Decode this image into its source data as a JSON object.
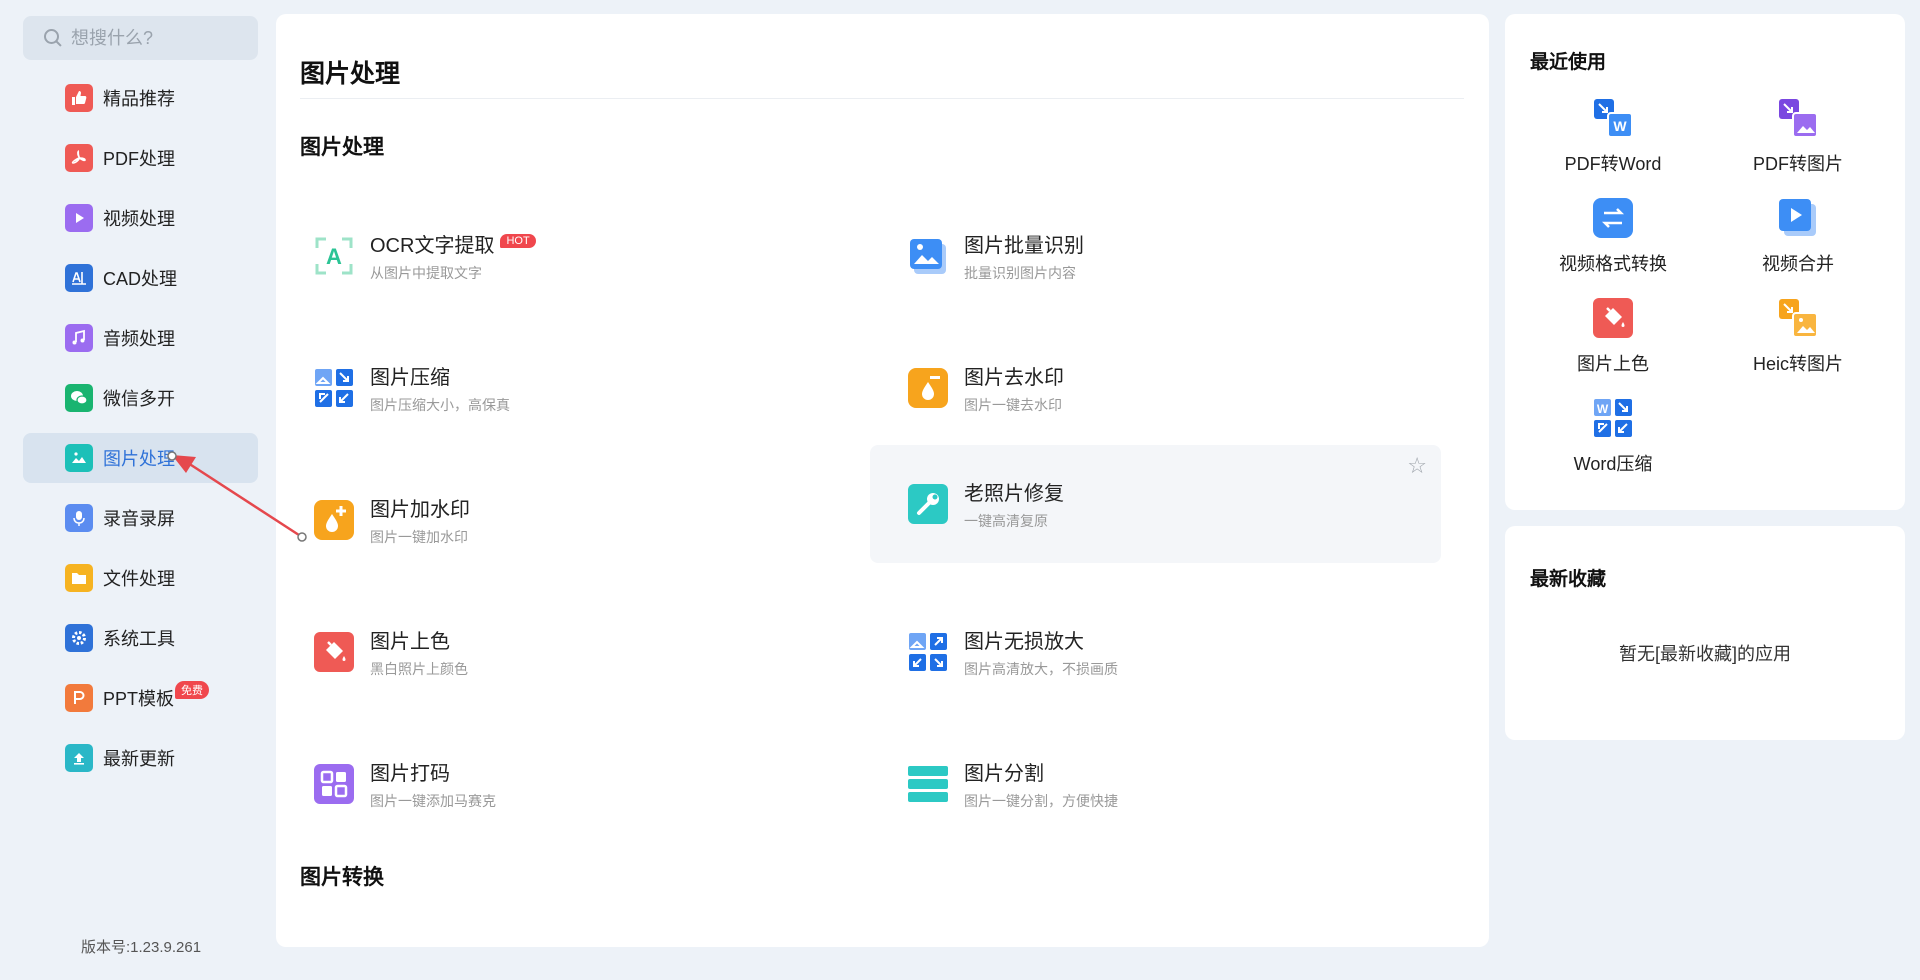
{
  "search": {
    "placeholder": "想搜什么?"
  },
  "sidebar": {
    "items": [
      {
        "label": "精品推荐",
        "icon": "thumbs-up-icon",
        "color": "#ef5a55"
      },
      {
        "label": "PDF处理",
        "icon": "pdf-icon",
        "color": "#ef5a55"
      },
      {
        "label": "视频处理",
        "icon": "video-play-icon",
        "color": "#9b6cf0"
      },
      {
        "label": "CAD处理",
        "icon": "cad-icon",
        "color": "#2f72d8"
      },
      {
        "label": "音频处理",
        "icon": "music-note-icon",
        "color": "#9b6cf0"
      },
      {
        "label": "微信多开",
        "icon": "wechat-icon",
        "color": "#19b470"
      },
      {
        "label": "图片处理",
        "icon": "image-icon",
        "color": "#1cc0b8"
      },
      {
        "label": "录音录屏",
        "icon": "microphone-icon",
        "color": "#5b8cf0"
      },
      {
        "label": "文件处理",
        "icon": "folder-icon",
        "color": "#f6b321"
      },
      {
        "label": "系统工具",
        "icon": "gear-icon",
        "color": "#2f72d8"
      },
      {
        "label": "PPT模板",
        "icon": "ppt-icon",
        "color": "#f27a3c",
        "badge": "免费"
      },
      {
        "label": "最新更新",
        "icon": "upload-icon",
        "color": "#2ab7c7"
      }
    ]
  },
  "version": "版本号:1.23.9.261",
  "main": {
    "title": "图片处理",
    "section1": "图片处理",
    "section2": "图片转换",
    "tools": [
      {
        "name": "OCR文字提取",
        "desc": "从图片中提取文字",
        "badge": "HOT",
        "icon": "ocr-text-icon",
        "color": "#2cc495"
      },
      {
        "name": "图片批量识别",
        "desc": "批量识别图片内容",
        "icon": "image-batch-icon",
        "color": "#3d8ef5"
      },
      {
        "name": "图片压缩",
        "desc": "图片压缩大小，高保真",
        "icon": "image-compress-icon",
        "color": "#3d8ef5"
      },
      {
        "name": "图片去水印",
        "desc": "图片一键去水印",
        "icon": "remove-watermark-icon",
        "color": "#f7a41d"
      },
      {
        "name": "图片加水印",
        "desc": "图片一键加水印",
        "icon": "add-watermark-icon",
        "color": "#f7a41d"
      },
      {
        "name": "老照片修复",
        "desc": "一键高清复原",
        "icon": "photo-repair-icon",
        "color": "#2cc9c4"
      },
      {
        "name": "图片上色",
        "desc": "黑白照片上颜色",
        "icon": "paint-bucket-icon",
        "color": "#ef5a55"
      },
      {
        "name": "图片无损放大",
        "desc": "图片高清放大，不损画质",
        "icon": "image-enlarge-icon",
        "color": "#3d8ef5"
      },
      {
        "name": "图片打码",
        "desc": "图片一键添加马赛克",
        "icon": "mosaic-icon",
        "color": "#9b6cf0"
      },
      {
        "name": "图片分割",
        "desc": "图片一键分割，方便快捷",
        "icon": "image-split-icon",
        "color": "#2cc9c4"
      }
    ]
  },
  "recent": {
    "title": "最近使用",
    "items": [
      {
        "label": "PDF转Word",
        "icon": "pdf-to-word-icon",
        "color": "#2f72d8"
      },
      {
        "label": "PDF转图片",
        "icon": "pdf-to-image-icon",
        "color": "#9b6cf0"
      },
      {
        "label": "视频格式转换",
        "icon": "video-convert-icon",
        "color": "#3d8ef5"
      },
      {
        "label": "视频合并",
        "icon": "video-merge-icon",
        "color": "#3d8ef5"
      },
      {
        "label": "图片上色",
        "icon": "paint-bucket-icon",
        "color": "#ef5a55"
      },
      {
        "label": "Heic转图片",
        "icon": "heic-to-image-icon",
        "color": "#f7a41d"
      },
      {
        "label": "Word压缩",
        "icon": "word-compress-icon",
        "color": "#3d8ef5"
      }
    ]
  },
  "favorites": {
    "title": "最新收藏",
    "empty_text": "暂无[最新收藏]的应用"
  },
  "colors": {
    "accent": "#2f72d8",
    "annotation": "#e5484d"
  }
}
